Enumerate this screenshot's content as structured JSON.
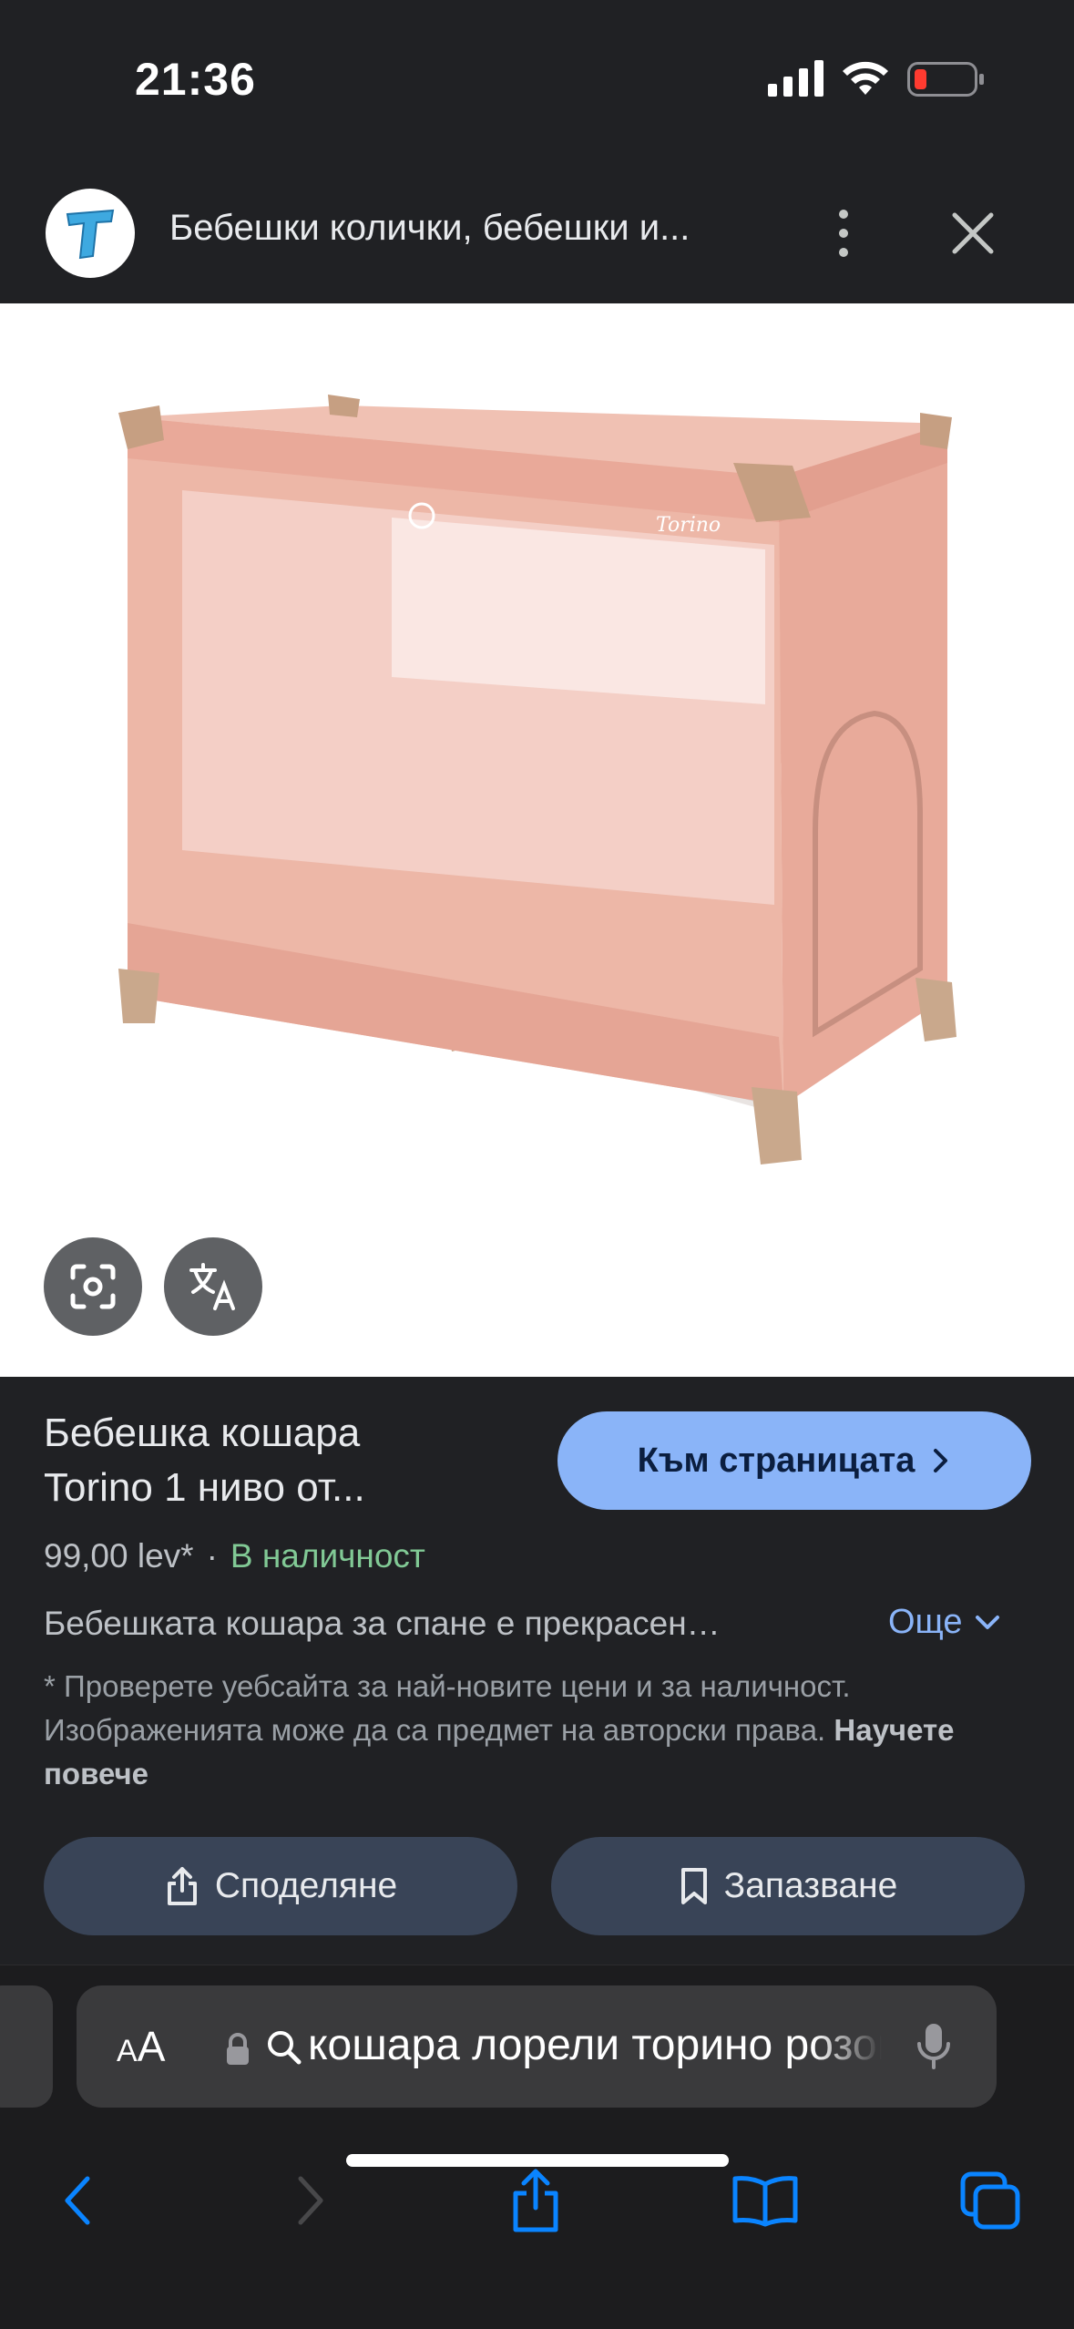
{
  "status_bar": {
    "time": "21:36"
  },
  "header": {
    "title": "Бебешки колички, бебешки и..."
  },
  "product": {
    "title_line1": "Бебешка кошара",
    "title_line2": "Torino 1 ниво от...",
    "price": "99,00 lev*",
    "separator": "·",
    "availability": "В наличност",
    "description": "Бебешката кошара за спане е прекрасен…",
    "more_label": "Още",
    "disclaimer": "* Проверете уебсайта за най-новите цени и за наличност. Изображенията може да са предмет на авторски права.",
    "learn_more": "Научете повече",
    "brand_text": "Torino"
  },
  "actions": {
    "visit_label": "Към страницата",
    "share_label": "Споделяне",
    "save_label": "Запазване"
  },
  "address_bar": {
    "aa_label_small": "A",
    "aa_label": "A",
    "url": "кошара лорели торино розова"
  },
  "colors": {
    "background": "#202124",
    "accent": "#8ab4f8",
    "in_stock": "#81c995",
    "chip": "#394457",
    "battery_low": "#ff3b30",
    "safari_blue": "#0a84ff"
  },
  "icons": [
    "signal-icon",
    "wifi-icon",
    "battery-icon",
    "more-vert-icon",
    "close-icon",
    "lens-icon",
    "translate-icon",
    "chevron-right-icon",
    "chevron-down-icon",
    "share-icon",
    "bookmark-icon",
    "lock-icon",
    "search-icon",
    "mic-icon",
    "back-icon",
    "forward-icon",
    "bookmarks-icon",
    "tabs-icon"
  ]
}
